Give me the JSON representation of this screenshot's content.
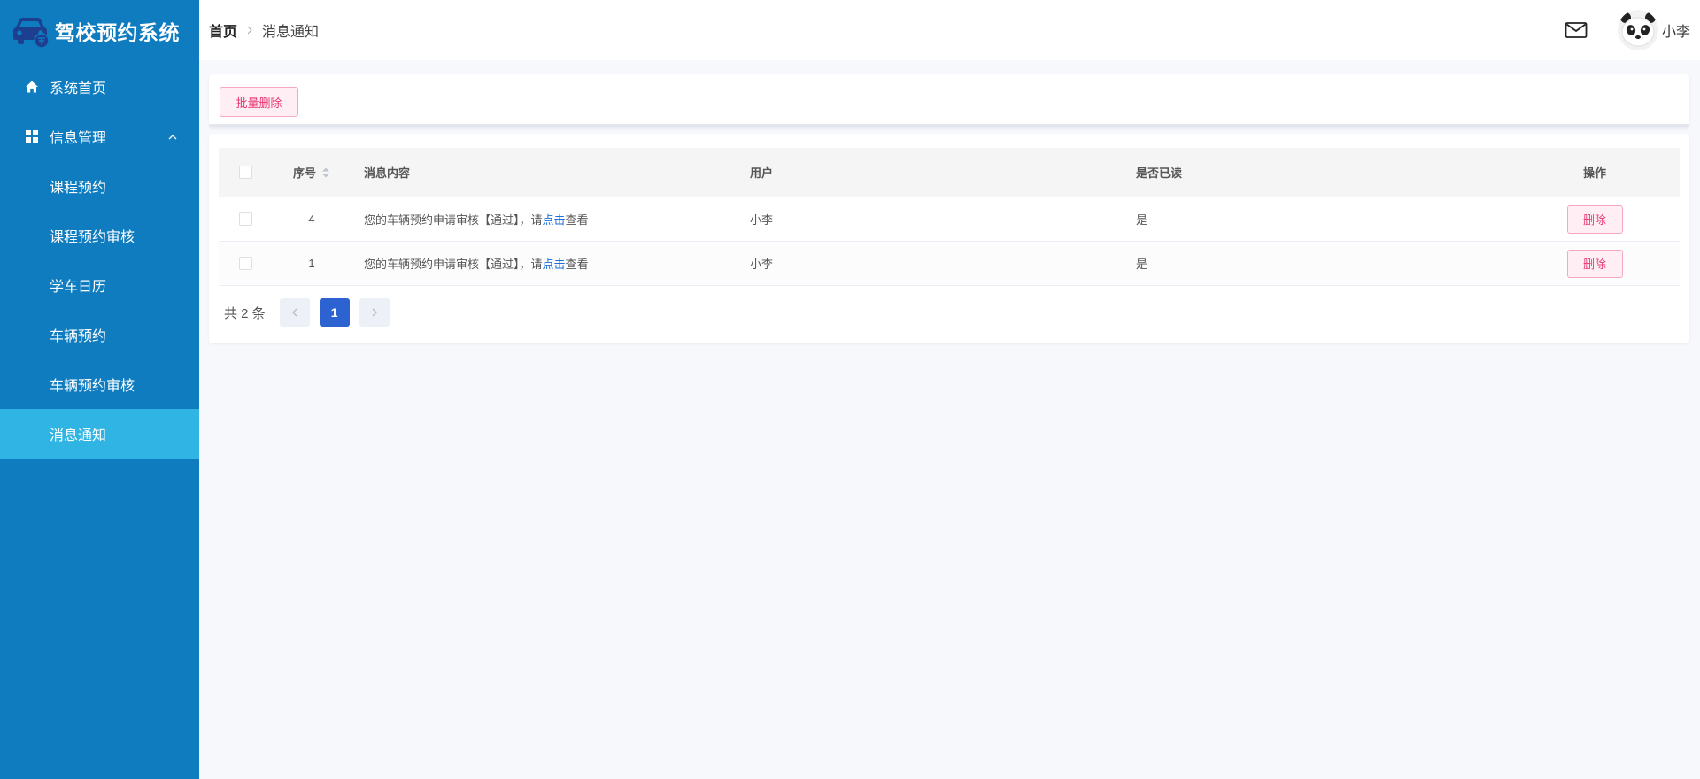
{
  "app": {
    "title": "驾校预约系统"
  },
  "sidebar": {
    "items": [
      {
        "label": "系统首页",
        "icon": "home-icon"
      },
      {
        "label": "信息管理",
        "icon": "grid-icon",
        "expanded": true
      }
    ],
    "submenu": [
      {
        "label": "课程预约"
      },
      {
        "label": "课程预约审核"
      },
      {
        "label": "学车日历"
      },
      {
        "label": "车辆预约"
      },
      {
        "label": "车辆预约审核"
      },
      {
        "label": "消息通知",
        "active": true
      }
    ]
  },
  "header": {
    "breadcrumb": {
      "home": "首页",
      "current": "消息通知"
    },
    "user": {
      "name": "小李"
    }
  },
  "toolbar": {
    "batch_delete_label": "批量删除"
  },
  "table": {
    "columns": {
      "index": "序号",
      "content": "消息内容",
      "user": "用户",
      "read": "是否已读",
      "op": "操作"
    },
    "rows": [
      {
        "index": "4",
        "content_prefix": "您的车辆预约申请审核【通过】，请",
        "content_link": "点击",
        "content_suffix": "查看",
        "user": "小李",
        "read": "是",
        "op_label": "删除"
      },
      {
        "index": "1",
        "content_prefix": "您的车辆预约申请审核【通过】，请",
        "content_link": "点击",
        "content_suffix": "查看",
        "user": "小李",
        "read": "是",
        "op_label": "删除"
      }
    ]
  },
  "pagination": {
    "total_text": "共 2 条",
    "current_page": "1"
  },
  "colors": {
    "sidebar": "#0f7cc0",
    "active_item": "#30b4e3",
    "danger": "#e8336f",
    "link": "#1e6fd9",
    "page_active": "#2d62d1"
  }
}
